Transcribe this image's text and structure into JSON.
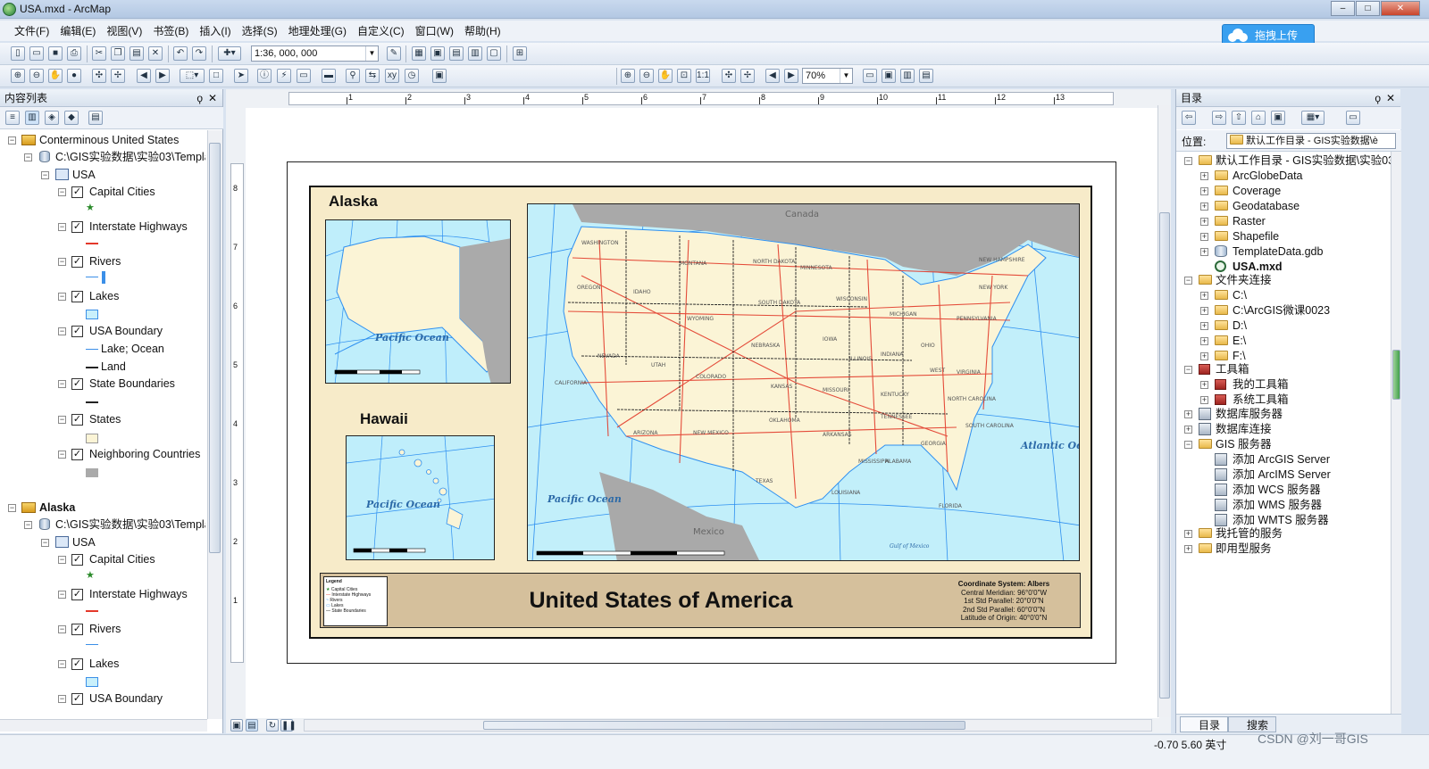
{
  "window": {
    "title": "USA.mxd - ArcMap",
    "min": "–",
    "max": "□",
    "close": "✕"
  },
  "menu": [
    "文件(F)",
    "编辑(E)",
    "视图(V)",
    "书签(B)",
    "插入(I)",
    "选择(S)",
    "地理处理(G)",
    "自定义(C)",
    "窗口(W)",
    "帮助(H)"
  ],
  "upload_button": "拖拽上传",
  "toolbar": {
    "scale": "1:36, 000, 000",
    "zoom": "70%"
  },
  "toc": {
    "title": "内容列表",
    "pin": "Α",
    "close": "✕",
    "frame1": {
      "name": "Conterminous United States",
      "source": "C:\\GIS实验数据\\实验03\\Templá",
      "group": "USA",
      "layers": [
        "Capital Cities",
        "Interstate Highways",
        "Rivers",
        "Lakes",
        "USA Boundary",
        "State Boundaries",
        "States",
        "Neighboring Countries"
      ],
      "boundary_classes": [
        "Lake; Ocean",
        "Land"
      ]
    },
    "frame2": {
      "name": "Alaska",
      "source": "C:\\GIS实验数据\\实验03\\Templá",
      "group": "USA",
      "layers": [
        "Capital Cities",
        "Interstate Highways",
        "Rivers",
        "Lakes",
        "USA Boundary"
      ]
    }
  },
  "layout": {
    "ruler_h": [
      "1",
      "2",
      "3",
      "4",
      "5",
      "6",
      "7",
      "8",
      "9",
      "10",
      "11",
      "12",
      "13"
    ],
    "ruler_v": [
      "8",
      "7",
      "6",
      "5",
      "4",
      "3",
      "2",
      "1"
    ],
    "alaska_title": "Alaska",
    "hawaii_title": "Hawaii",
    "map_title": "United States of America",
    "pacific": "Pacific Ocean",
    "atlantic": "Atlantic Ocean",
    "canada": "Canada",
    "mexico": "Mexico",
    "gulf": "Gulf of Mexico",
    "legend": {
      "title": "Legend",
      "items": [
        "Capital Cities",
        "Interstate Highways",
        "Rivers",
        "Lakes",
        "State Boundaries"
      ]
    },
    "coords": [
      "Coordinate System: Albers",
      "Central Meridian: 96°0'0\"W",
      "1st Std Parallel: 20°0'0\"N",
      "2nd Std Parallel: 60°0'0\"N",
      "Latitude of Origin: 40°0'0\"N"
    ],
    "states": [
      "WASHINGTON",
      "OREGON",
      "IDAHO",
      "MONTANA",
      "NORTH DAKOTA",
      "MINNESOTA",
      "SOUTH DAKOTA",
      "WYOMING",
      "NEBRASKA",
      "IOWA",
      "NEVADA",
      "UTAH",
      "COLORADO",
      "KANSAS",
      "MISSOURI",
      "CALIFORNIA",
      "ARIZONA",
      "NEW MEXICO",
      "TEXAS",
      "OKLAHOMA",
      "ARKANSAS",
      "LOUISIANA",
      "MISSISSIPPI",
      "ALABAMA",
      "GEORGIA",
      "FLORIDA",
      "TENNESSEE",
      "KENTUCKY",
      "WISCONSIN",
      "MICHIGAN",
      "ILLINOIS",
      "INDIANA",
      "OHIO",
      "PENNSYLVANIA",
      "NEW YORK",
      "NEW HAMPSHIRE",
      "VIRGINIA",
      "NORTH CAROLINA",
      "SOUTH CAROLINA",
      "WEST"
    ]
  },
  "catalog": {
    "title": "目录",
    "location_label": "位置:",
    "location_value": "默认工作目录 - GIS实验数据\\è",
    "root": "默认工作目录 - GIS实验数据\\实验03",
    "root_items": [
      "ArcGlobeData",
      "Coverage",
      "Geodatabase",
      "Raster",
      "Shapefile",
      "TemplateData.gdb",
      "USA.mxd"
    ],
    "folder_conn": "文件夹连接",
    "folder_items": [
      "C:\\",
      "C:\\ArcGIS微课0023",
      "D:\\",
      "E:\\",
      "F:\\"
    ],
    "toolbox": "工具箱",
    "toolbox_items": [
      "我的工具箱",
      "系统工具箱"
    ],
    "db_servers": "数据库服务器",
    "db_conn": "数据库连接",
    "gis_servers": "GIS 服务器",
    "gis_items": [
      "添加 ArcGIS Server",
      "添加 ArcIMS Server",
      "添加 WCS 服务器",
      "添加 WMS 服务器",
      "添加 WMTS 服务器"
    ],
    "hosted": "我托管的服务",
    "ready": "即用型服务",
    "tabs": [
      "目录",
      "搜索"
    ]
  },
  "status": {
    "coords": "-0.70  5.60 英寸"
  },
  "watermark": "CSDN @刘一哥GIS"
}
